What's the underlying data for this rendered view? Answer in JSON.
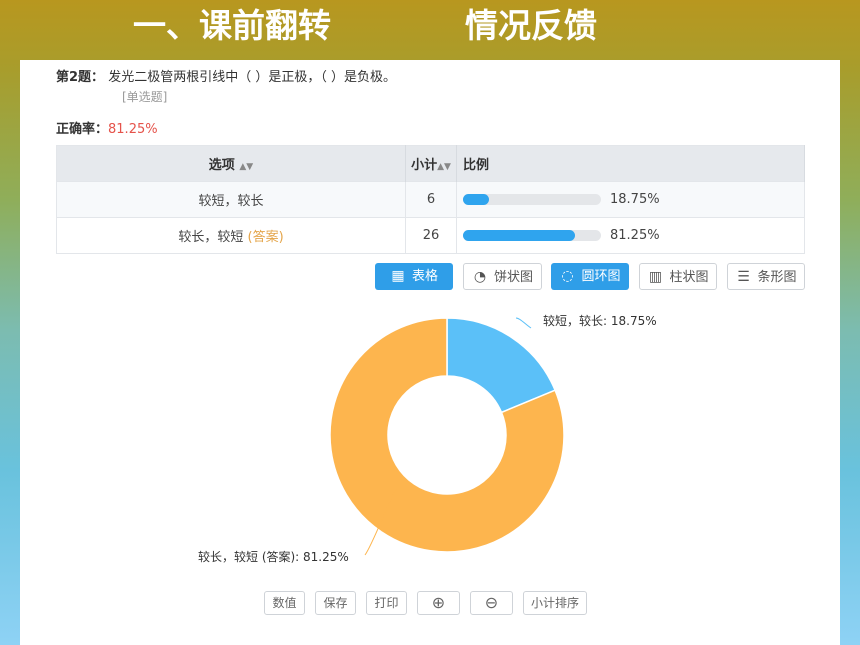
{
  "header": {
    "title_part1": "一、课前翻转",
    "title_part2": "情况反馈"
  },
  "question": {
    "number_label": "第2题：",
    "text": "发光二极管两根引线中（   ）是正极，（   ）是负极。",
    "type": "[单选题]"
  },
  "accuracy": {
    "label": "正确率：",
    "value": "81.25%"
  },
  "table": {
    "headers": {
      "option": "选项",
      "count": "小计",
      "ratio": "比例"
    },
    "rows": [
      {
        "option": "较短，较长",
        "answer_tag": "",
        "count": "6",
        "percent": "18.75%",
        "fraction": 0.1875
      },
      {
        "option": "较长，较短",
        "answer_tag": "(答案)",
        "count": "26",
        "percent": "81.25%",
        "fraction": 0.8125
      }
    ]
  },
  "toolbar": {
    "table": "表格",
    "pie": "饼状图",
    "donut": "圆环图",
    "column": "柱状图",
    "barh": "条形图",
    "active": [
      "table",
      "donut"
    ]
  },
  "chart_data": {
    "type": "pie",
    "variant": "donut",
    "series": [
      {
        "name": "较短，较长",
        "value": 18.75,
        "color": "#5bc0f8"
      },
      {
        "name": "较长，较短 (答案)",
        "value": 81.25,
        "color": "#fdb54e"
      }
    ],
    "labels": [
      "较短，较长: 18.75%",
      "较长，较短 (答案): 81.25%"
    ]
  },
  "bottom_buttons": {
    "values": "数值",
    "save": "保存",
    "print": "打印",
    "sort": "小计排序"
  },
  "colors": {
    "accent": "#2f9ee8",
    "accuracy": "#e5534b",
    "answer": "#e4a54a"
  }
}
